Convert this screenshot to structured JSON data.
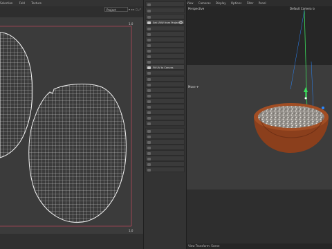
{
  "uv_editor": {
    "menu": [
      "Selection",
      "Fold",
      "Texture"
    ],
    "project_dropdown": "Project",
    "toolbar_icons": "▾ ◂ ▸ ◻ ⤢",
    "corner_top_right": "1,0",
    "corner_bottom_right": "1,0"
  },
  "commands": [
    {
      "label": "Set UVW from Projection",
      "highlight": true,
      "add": true
    },
    {
      "label": "Fit UV to Canvas",
      "highlight": true,
      "add": false
    }
  ],
  "viewport": {
    "menu": [
      "View",
      "Cameras",
      "Display",
      "Options",
      "Filter",
      "Panel"
    ],
    "view_label": "Perspective",
    "camera_label": "Default Camera ↻",
    "move_label": "Move ✛",
    "bottom_label": "View Transform: Scene"
  },
  "colors": {
    "pot": "#8b3f1c",
    "pot_rim": "#a24e24",
    "gravel": "#b8b4ad",
    "axis_green": "#3be05c",
    "axis_blue": "#2b88ff",
    "uv_line": "#e6e6e6",
    "uv_border": "#b5475a"
  }
}
